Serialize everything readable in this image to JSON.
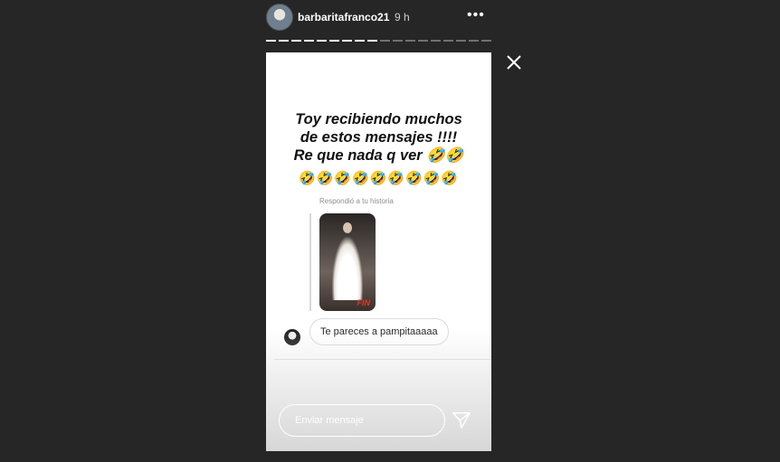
{
  "header": {
    "username": "barbaritafranco21",
    "time": "9 h",
    "more_icon": "more-horizontal-icon"
  },
  "progress": {
    "total_segments": 18,
    "completed_segments": 9
  },
  "story": {
    "headline_lines": [
      "Toy recibiendo muchos",
      "de estos mensajes !!!!",
      "Re que nada q ver 🤣🤣"
    ],
    "emoji_row": "🤣🤣🤣🤣🤣🤣🤣🤣🤣",
    "reply_label": "Respondió a tu historia",
    "thumbnail_caption": "FIN",
    "message": "Te pareces a pampitaaaaa"
  },
  "footer": {
    "placeholder": "Enviar mensaje",
    "send_icon": "send-paper-plane-icon"
  },
  "controls": {
    "close_icon": "close-icon"
  },
  "colors": {
    "background": "#262626",
    "text_white": "#ffffff",
    "accent_red": "#e0342b"
  }
}
